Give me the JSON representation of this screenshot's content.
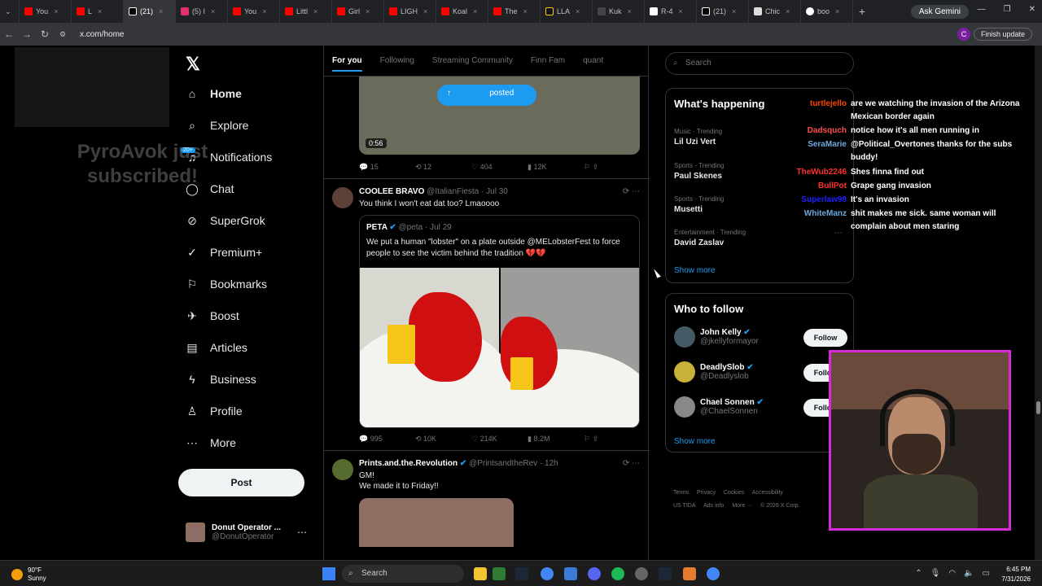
{
  "browser": {
    "tabs": [
      {
        "label": "You"
      },
      {
        "label": "L"
      },
      {
        "label": "(21)"
      },
      {
        "label": "(5) I"
      },
      {
        "label": "You"
      },
      {
        "label": "Littl"
      },
      {
        "label": "Girl"
      },
      {
        "label": "LIGH"
      },
      {
        "label": "Koal"
      },
      {
        "label": "The"
      },
      {
        "label": "LLA"
      },
      {
        "label": "Kuk"
      },
      {
        "label": "R-4"
      },
      {
        "label": "(21)"
      },
      {
        "label": "Chic"
      },
      {
        "label": "boo"
      }
    ],
    "new_tab": "+",
    "ask_gemini": "Ask Gemini",
    "url": "x.com/home",
    "profile_initial": "C",
    "finish_update": "Finish update"
  },
  "overlay": {
    "subscribed_text": "PyroAvok just subscribed!"
  },
  "nav": {
    "items": [
      {
        "label": "Home",
        "icon": "home-icon"
      },
      {
        "label": "Explore",
        "icon": "search-icon"
      },
      {
        "label": "Notifications",
        "icon": "bell-icon"
      },
      {
        "label": "Chat",
        "icon": "chat-icon"
      },
      {
        "label": "SuperGrok",
        "icon": "grok-icon"
      },
      {
        "label": "Premium+",
        "icon": "premium-icon"
      },
      {
        "label": "Bookmarks",
        "icon": "bookmark-icon"
      },
      {
        "label": "Boost",
        "icon": "boost-icon"
      },
      {
        "label": "Articles",
        "icon": "articles-icon"
      },
      {
        "label": "Business",
        "icon": "business-icon"
      },
      {
        "label": "Profile",
        "icon": "profile-icon"
      },
      {
        "label": "More",
        "icon": "more-icon"
      }
    ],
    "notif_badge": "20+",
    "post_label": "Post",
    "account_name": "Donut Operator ...",
    "account_handle": "@DonutOperator"
  },
  "timeline": {
    "tabs": [
      "For you",
      "Following",
      "Streaming Community",
      "Finn Fam",
      "quant"
    ],
    "posted_label": "posted",
    "video_duration": "0:56",
    "video_actions": {
      "replies": "15",
      "reposts": "12",
      "likes": "404",
      "views": "12K"
    },
    "tweet1": {
      "name": "COOLEE BRAVO",
      "handle": "@ItalianFiesta · Jul 30",
      "text": "You think I won't eat dat too? Lmaoooo",
      "quote_name": "PETA",
      "quote_handle": "@peta · Jul 29",
      "quote_text": "We put a human \"lobster\" on a plate outside @MELobsterFest to force people to see the victim behind the tradition 💔💔",
      "actions": {
        "replies": "995",
        "reposts": "10K",
        "likes": "214K",
        "views": "8.2M"
      }
    },
    "tweet2": {
      "name": "Prints.and.the.Revolution",
      "handle": "@PrintsandtheRev · 12h",
      "text": "GM!\nWe made it to Friday!!"
    }
  },
  "right": {
    "search_placeholder": "Search",
    "happening_title": "What's happening",
    "trends": [
      {
        "meta": "Music · Trending",
        "topic": "Lil Uzi Vert"
      },
      {
        "meta": "Sports · Trending",
        "topic": "Paul Skenes"
      },
      {
        "meta": "Sports · Trending",
        "topic": "Musetti"
      },
      {
        "meta": "Entertainment · Trending",
        "topic": "David Zaslav"
      }
    ],
    "show_more": "Show more",
    "who_title": "Who to follow",
    "who": [
      {
        "name": "John Kelly",
        "handle": "@jkellyformayor"
      },
      {
        "name": "DeadlySlob",
        "handle": "@Deadlyslob"
      },
      {
        "name": "Chael Sonnen",
        "handle": "@ChaelSonnen"
      }
    ],
    "follow_label": "Follow",
    "footer": [
      "Terms",
      "Privacy",
      "Cookies",
      "Accessibility",
      "US TIDA",
      "Ads info",
      "More ···",
      "© 2026 X Corp."
    ]
  },
  "chat": [
    {
      "user": "turtlejello",
      "color": "#ff4500",
      "msg": "are we watching the invasion of the Arizona Mexican border again"
    },
    {
      "user": "Dadsquch",
      "color": "#ff4f4f",
      "msg": "notice how it's all men running in"
    },
    {
      "user": "SeraMarie",
      "color": "#6fa8dc",
      "msg": "@Political_Overtones thanks for the subs buddy!"
    },
    {
      "user": "TheWub2246",
      "color": "#ff3030",
      "msg": "Shes finna find out"
    },
    {
      "user": "BullPot",
      "color": "#ff3030",
      "msg": "Grape gang invasion"
    },
    {
      "user": "Superlaw98",
      "color": "#2020ff",
      "msg": "It's an invasion"
    },
    {
      "user": "WhiteManz",
      "color": "#6fa8dc",
      "msg": "shit makes me sick. same woman will complain about men staring"
    }
  ],
  "taskbar": {
    "temp": "90°F",
    "weather": "Sunny",
    "search_label": "Search",
    "time": "6:45 PM",
    "date": "7/31/2026"
  }
}
